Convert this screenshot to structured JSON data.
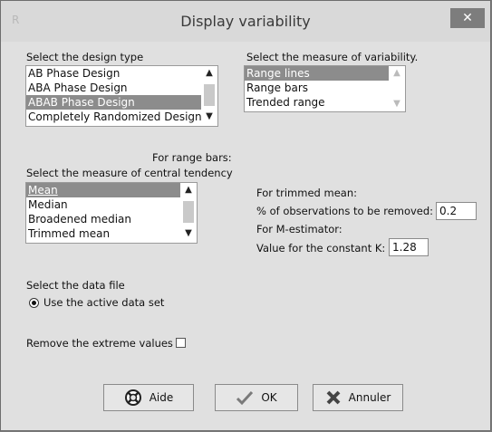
{
  "window": {
    "title": "Display variability",
    "app_icon_text": "R",
    "close_glyph": "✕"
  },
  "design_type": {
    "label": "Select the design type",
    "items": [
      "AB Phase Design",
      "ABA Phase Design",
      "ABAB Phase Design",
      "Completely Randomized Design"
    ],
    "selected": "ABAB Phase Design"
  },
  "variability": {
    "label": "Select the measure of variability.",
    "items": [
      "Range lines",
      "Range bars",
      "Trended range"
    ],
    "selected": "Range lines"
  },
  "central_tendency": {
    "for_range_bars": "For range bars:",
    "label": "Select the measure of central tendency",
    "items": [
      "Mean",
      "Median",
      "Broadened median",
      "Trimmed mean"
    ],
    "selected": "Mean"
  },
  "trimmed_mean": {
    "heading": "For trimmed mean:",
    "pct_label": "% of observations to be removed:",
    "pct_value": "0.2"
  },
  "m_estimator": {
    "heading": "For M-estimator:",
    "k_label": "Value for the constant K:",
    "k_value": "1.28"
  },
  "data_file": {
    "label": "Select the data file",
    "option": "Use the active data set"
  },
  "extreme": {
    "label": "Remove the extreme values",
    "checked": false
  },
  "buttons": {
    "help": "Aide",
    "ok": "OK",
    "cancel": "Annuler"
  }
}
